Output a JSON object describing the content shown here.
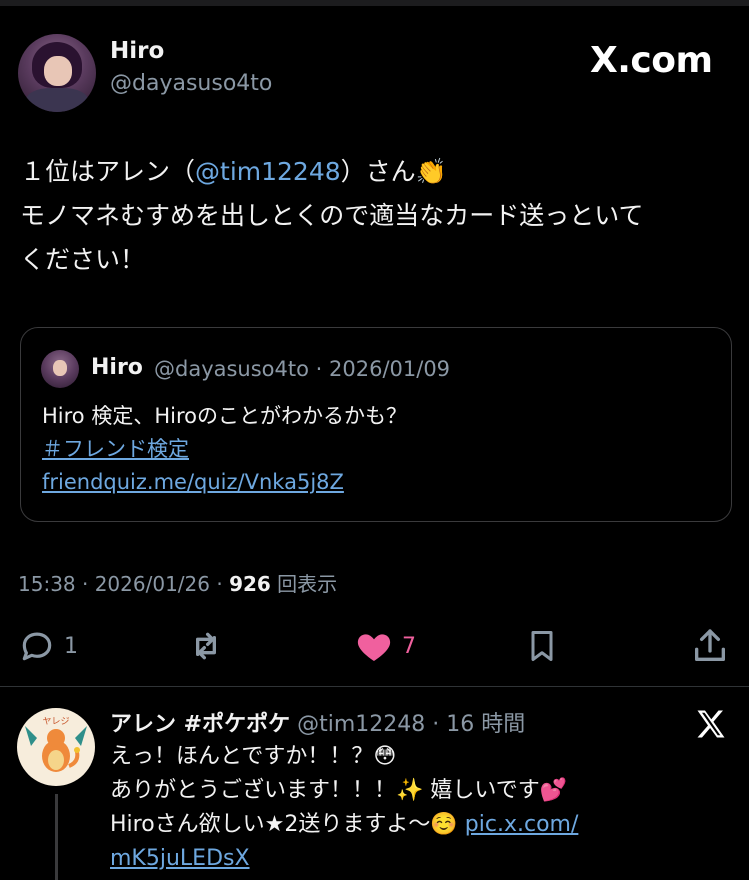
{
  "post": {
    "author_name": "Hiro",
    "author_handle": "@dayasuso4to",
    "brand": "X.com",
    "text_line1_prefix": "１位はアレン（",
    "text_mention": "@tim12248",
    "text_line1_suffix": "）さん👏",
    "text_line2": "モノマネむすめを出しとくので適当なカード送っといて",
    "text_line3": "ください！"
  },
  "quote": {
    "author_name": "Hiro",
    "meta": "@dayasuso4to · 2026/01/09",
    "text": "Hiro 検定、Hiroのことがわかるかも？",
    "hashtag": " ＃フレンド検定",
    "link": "friendquiz.me/quiz/Vnka5j8Z"
  },
  "stats": {
    "time": "15:38 · 2026/01/26 · ",
    "views_count": "926",
    "views_label": " 回表示"
  },
  "actions": {
    "reply_count": "1",
    "like_count": "7",
    "colors": {
      "icon": "#8b98a5",
      "like": "#f0609e"
    }
  },
  "reply": {
    "author_name": "アレン #ポケポケ",
    "meta": " @tim12248 · 16 時間",
    "line1": "えっ！ほんとですか！！？😳",
    "line2": "ありがとうございます！！！✨ 嬉しいです💕",
    "line3": "Hiroさん欲しい★2送りますよ〜☺️ ",
    "link_part1": "pic.x.com/",
    "link_part2": "mK5juLEDsX",
    "avatar_label": "ヤレジ"
  }
}
